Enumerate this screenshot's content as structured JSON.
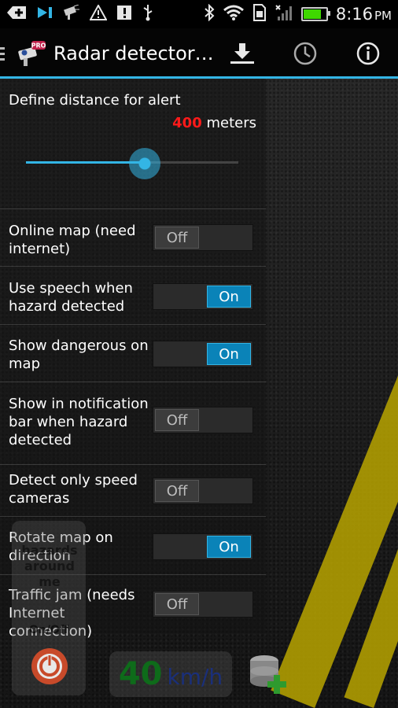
{
  "status_bar": {
    "time": "8:16",
    "ampm": "PM",
    "battery_level": 0.85,
    "icons": [
      "add-icon",
      "play-icon",
      "camera-icon",
      "warning-icon",
      "alert-icon",
      "usb-icon",
      "bluetooth-icon",
      "wifi-icon",
      "sim-icon",
      "signal-icon",
      "battery-icon"
    ]
  },
  "action_bar": {
    "title": "Radar detector…",
    "badge": "PRO",
    "actions": [
      "download-icon",
      "history-icon",
      "info-icon"
    ]
  },
  "distance": {
    "label": "Define distance for alert",
    "value": "400",
    "unit": "meters",
    "slider_fraction": 0.56
  },
  "settings": [
    {
      "label": "Online map (need internet)",
      "state": "Off"
    },
    {
      "label": "Use speech when hazard detected",
      "state": "On"
    },
    {
      "label": "Show dangerous on map",
      "state": "On"
    },
    {
      "label": "Show in notification bar when hazard detected",
      "state": "Off"
    },
    {
      "label": "Detect only speed cameras",
      "state": "Off"
    },
    {
      "label": "Rotate map on direction",
      "state": "On"
    },
    {
      "label": "Traffic jam (needs Internet connection)",
      "state": "Off"
    }
  ],
  "bottom": {
    "hazards_label": "hazards around me",
    "onoff_label": "On/Off",
    "speed_value": "40",
    "speed_unit": "km/h"
  },
  "colors": {
    "accent": "#33b5e5",
    "toggle_on": "#0a83b8",
    "distance_value": "#ff1a1a",
    "speed": "#0e6b1a"
  }
}
